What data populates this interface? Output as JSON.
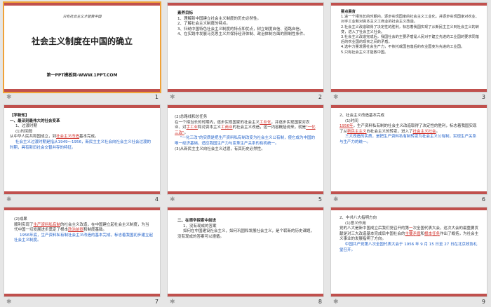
{
  "slides": [
    {
      "number": "1",
      "tagline": "只有社会主义才能救中国",
      "title": "社会主义制度在中国的确立",
      "subtitle": "第一PPT模板网-WWW.1PPT.COM"
    },
    {
      "number": "2",
      "heading": "素养目标",
      "lines": [
        "1、理解新中国建立社会主义制度的历史必然性。",
        "2、了解社会主义制度的特点。",
        "3、归纳中国特色社会主义制度的特点和优点，树立制度自信、道路自信。",
        "4、在实践中发展马克思主义并保持经济体制、政治体制方面的限制性条件。"
      ]
    },
    {
      "number": "3",
      "heading": "要点展背",
      "lines": [
        "1.进一个相当长的时期内，逐步实现国家的社会主义工业化，并逐步实现国家对农业、对手工业和对资本主义工商业的社会主义改造。",
        "2.社会主义改造取得了决定性的胜利，标志着我国实现了从新民主主义到社会主义的转变，进入了社会主义社会。",
        "3.社会主义改造完成后，我国社会的主要矛盾是人民对于建立先进的工业国的要求同落后的农业国的现实之间的矛盾。",
        "4.选中力量发展社会生产力，不依托或国自落后的农业国变为先进的工业国。",
        "5.只有社会主义才能救中国。"
      ]
    },
    {
      "number": "4",
      "tag": "【学新知】",
      "lines": [
        "一、最深刻最伟大的社会变革",
        "1、过渡时期",
        "(1)时间段",
        "从中华人民共和国成立，到",
        "社会主义改造",
        "基本完成。",
        "社会主义过渡时期是指从1949～1956，新民主主义社会向社会主义社会过渡的时期，具有新旧社会交替并存的特征。"
      ]
    },
    {
      "number": "5",
      "lines": [
        "(2)总路线和总任务",
        "在一个相当长的时期内，逐步实现国家的社会主义",
        "工业化",
        "，并逐步实现国家对农业、对",
        "手工业",
        "和对资本主义",
        "工商业",
        "的社会主义改造，这一内容概括说来，就是",
        "\"一化三改\"",
        "。",
        "\"一化三改\"的实质是把生产资料私有制改变为社会主义公有制，使它成为中国的唯一经济基础，适应我国生产力与变革生产关系的有机统一。",
        "(3)从新民主主义向社会主义过渡，有其历史必然性。"
      ]
    },
    {
      "number": "6",
      "lines": [
        "2、社会主义改造基本完成",
        "(1)时间",
        "1956年",
        "，生产资料私有制的社会主义改造取得了决定性的胜利，标志着我国实现了从",
        "新民主主义",
        "向社会主义的转变，进入了",
        "社会主义社会",
        "。",
        "三大改造的实质，是把生产资料私有制转变为社会主义公有制，实现生产关系与生产力的统一。"
      ]
    },
    {
      "number": "7",
      "lines": [
        "(2)成果",
        "顺利实现了",
        "生产资料私有制",
        "的社会主义改造，在中国建立起社会主义制度，为当代中国一切发展进步奠定了根本",
        "政治前提",
        "和制度基础。",
        "1956年底，生产资料私有制社会主义改造的基本完成，标志着我国初步建立起社会主义制度。"
      ]
    },
    {
      "number": "8",
      "lines": [
        "二、在艰辛探索中前进",
        "1、没有现成的答案",
        "如何在中国建设社会主义，如何巩固和发展社会主义，是个崭新的历史课题，没有现成的答案可以遵循。"
      ]
    },
    {
      "number": "9",
      "lines": [
        "2、中共八大指明方向",
        "(1)意义作用",
        "党的八大是新中国成立后我们党召开的第",
        "一",
        "次全国代表大会，这次大会的最重要贡献是对三大改造基本完成后中国社会的",
        "主要矛盾",
        "和",
        "根本任务",
        "作出了概括，为社会主义事业的发展指明了方向。",
        "中国共产党第八次全国代表大会于 1956 年 9 月 15 日至 27 日在北京政协礼堂召开。"
      ]
    }
  ],
  "colors": {
    "accent_bar": "#c0504d",
    "selected_border": "#f0a238",
    "link_blue": "#1f5fc8",
    "highlight_red": "#d0302a"
  },
  "footer_icon": "star-icon"
}
